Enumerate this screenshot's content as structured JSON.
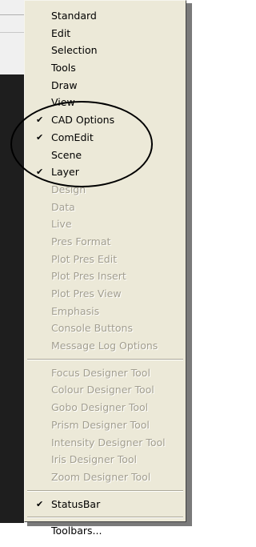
{
  "menu": {
    "group1": [
      {
        "label": "Standard",
        "checked": false,
        "enabled": true
      },
      {
        "label": "Edit",
        "checked": false,
        "enabled": true
      },
      {
        "label": "Selection",
        "checked": false,
        "enabled": true
      },
      {
        "label": "Tools",
        "checked": false,
        "enabled": true
      },
      {
        "label": "Draw",
        "checked": false,
        "enabled": true
      },
      {
        "label": "View",
        "checked": false,
        "enabled": true
      },
      {
        "label": "CAD Options",
        "checked": true,
        "enabled": true
      },
      {
        "label": "ComEdit",
        "checked": true,
        "enabled": true
      },
      {
        "label": "Scene",
        "checked": false,
        "enabled": true
      },
      {
        "label": "Layer",
        "checked": true,
        "enabled": true
      },
      {
        "label": "Design",
        "checked": false,
        "enabled": false
      },
      {
        "label": "Data",
        "checked": false,
        "enabled": false
      },
      {
        "label": "Live",
        "checked": false,
        "enabled": false
      },
      {
        "label": "Pres Format",
        "checked": false,
        "enabled": false
      },
      {
        "label": "Plot Pres Edit",
        "checked": false,
        "enabled": false
      },
      {
        "label": "Plot Pres Insert",
        "checked": false,
        "enabled": false
      },
      {
        "label": "Plot Pres View",
        "checked": false,
        "enabled": false
      },
      {
        "label": "Emphasis",
        "checked": false,
        "enabled": false
      },
      {
        "label": "Console Buttons",
        "checked": false,
        "enabled": false
      },
      {
        "label": "Message Log Options",
        "checked": false,
        "enabled": false
      }
    ],
    "group2": [
      {
        "label": "Focus Designer Tool",
        "checked": false,
        "enabled": false
      },
      {
        "label": "Colour Designer Tool",
        "checked": false,
        "enabled": false
      },
      {
        "label": "Gobo Designer Tool",
        "checked": false,
        "enabled": false
      },
      {
        "label": "Prism Designer Tool",
        "checked": false,
        "enabled": false
      },
      {
        "label": "Intensity Designer Tool",
        "checked": false,
        "enabled": false
      },
      {
        "label": "Iris Designer Tool",
        "checked": false,
        "enabled": false
      },
      {
        "label": "Zoom Designer Tool",
        "checked": false,
        "enabled": false
      }
    ],
    "group3": [
      {
        "label": "StatusBar",
        "checked": true,
        "enabled": true
      }
    ],
    "group4": [
      {
        "label": "Toolbars...",
        "checked": false,
        "enabled": true
      }
    ],
    "check_glyph": "✔",
    "colors": {
      "menu_bg": "#ece9d8",
      "disabled_text": "#a29e8f",
      "annotation_circle": "#000000"
    }
  }
}
